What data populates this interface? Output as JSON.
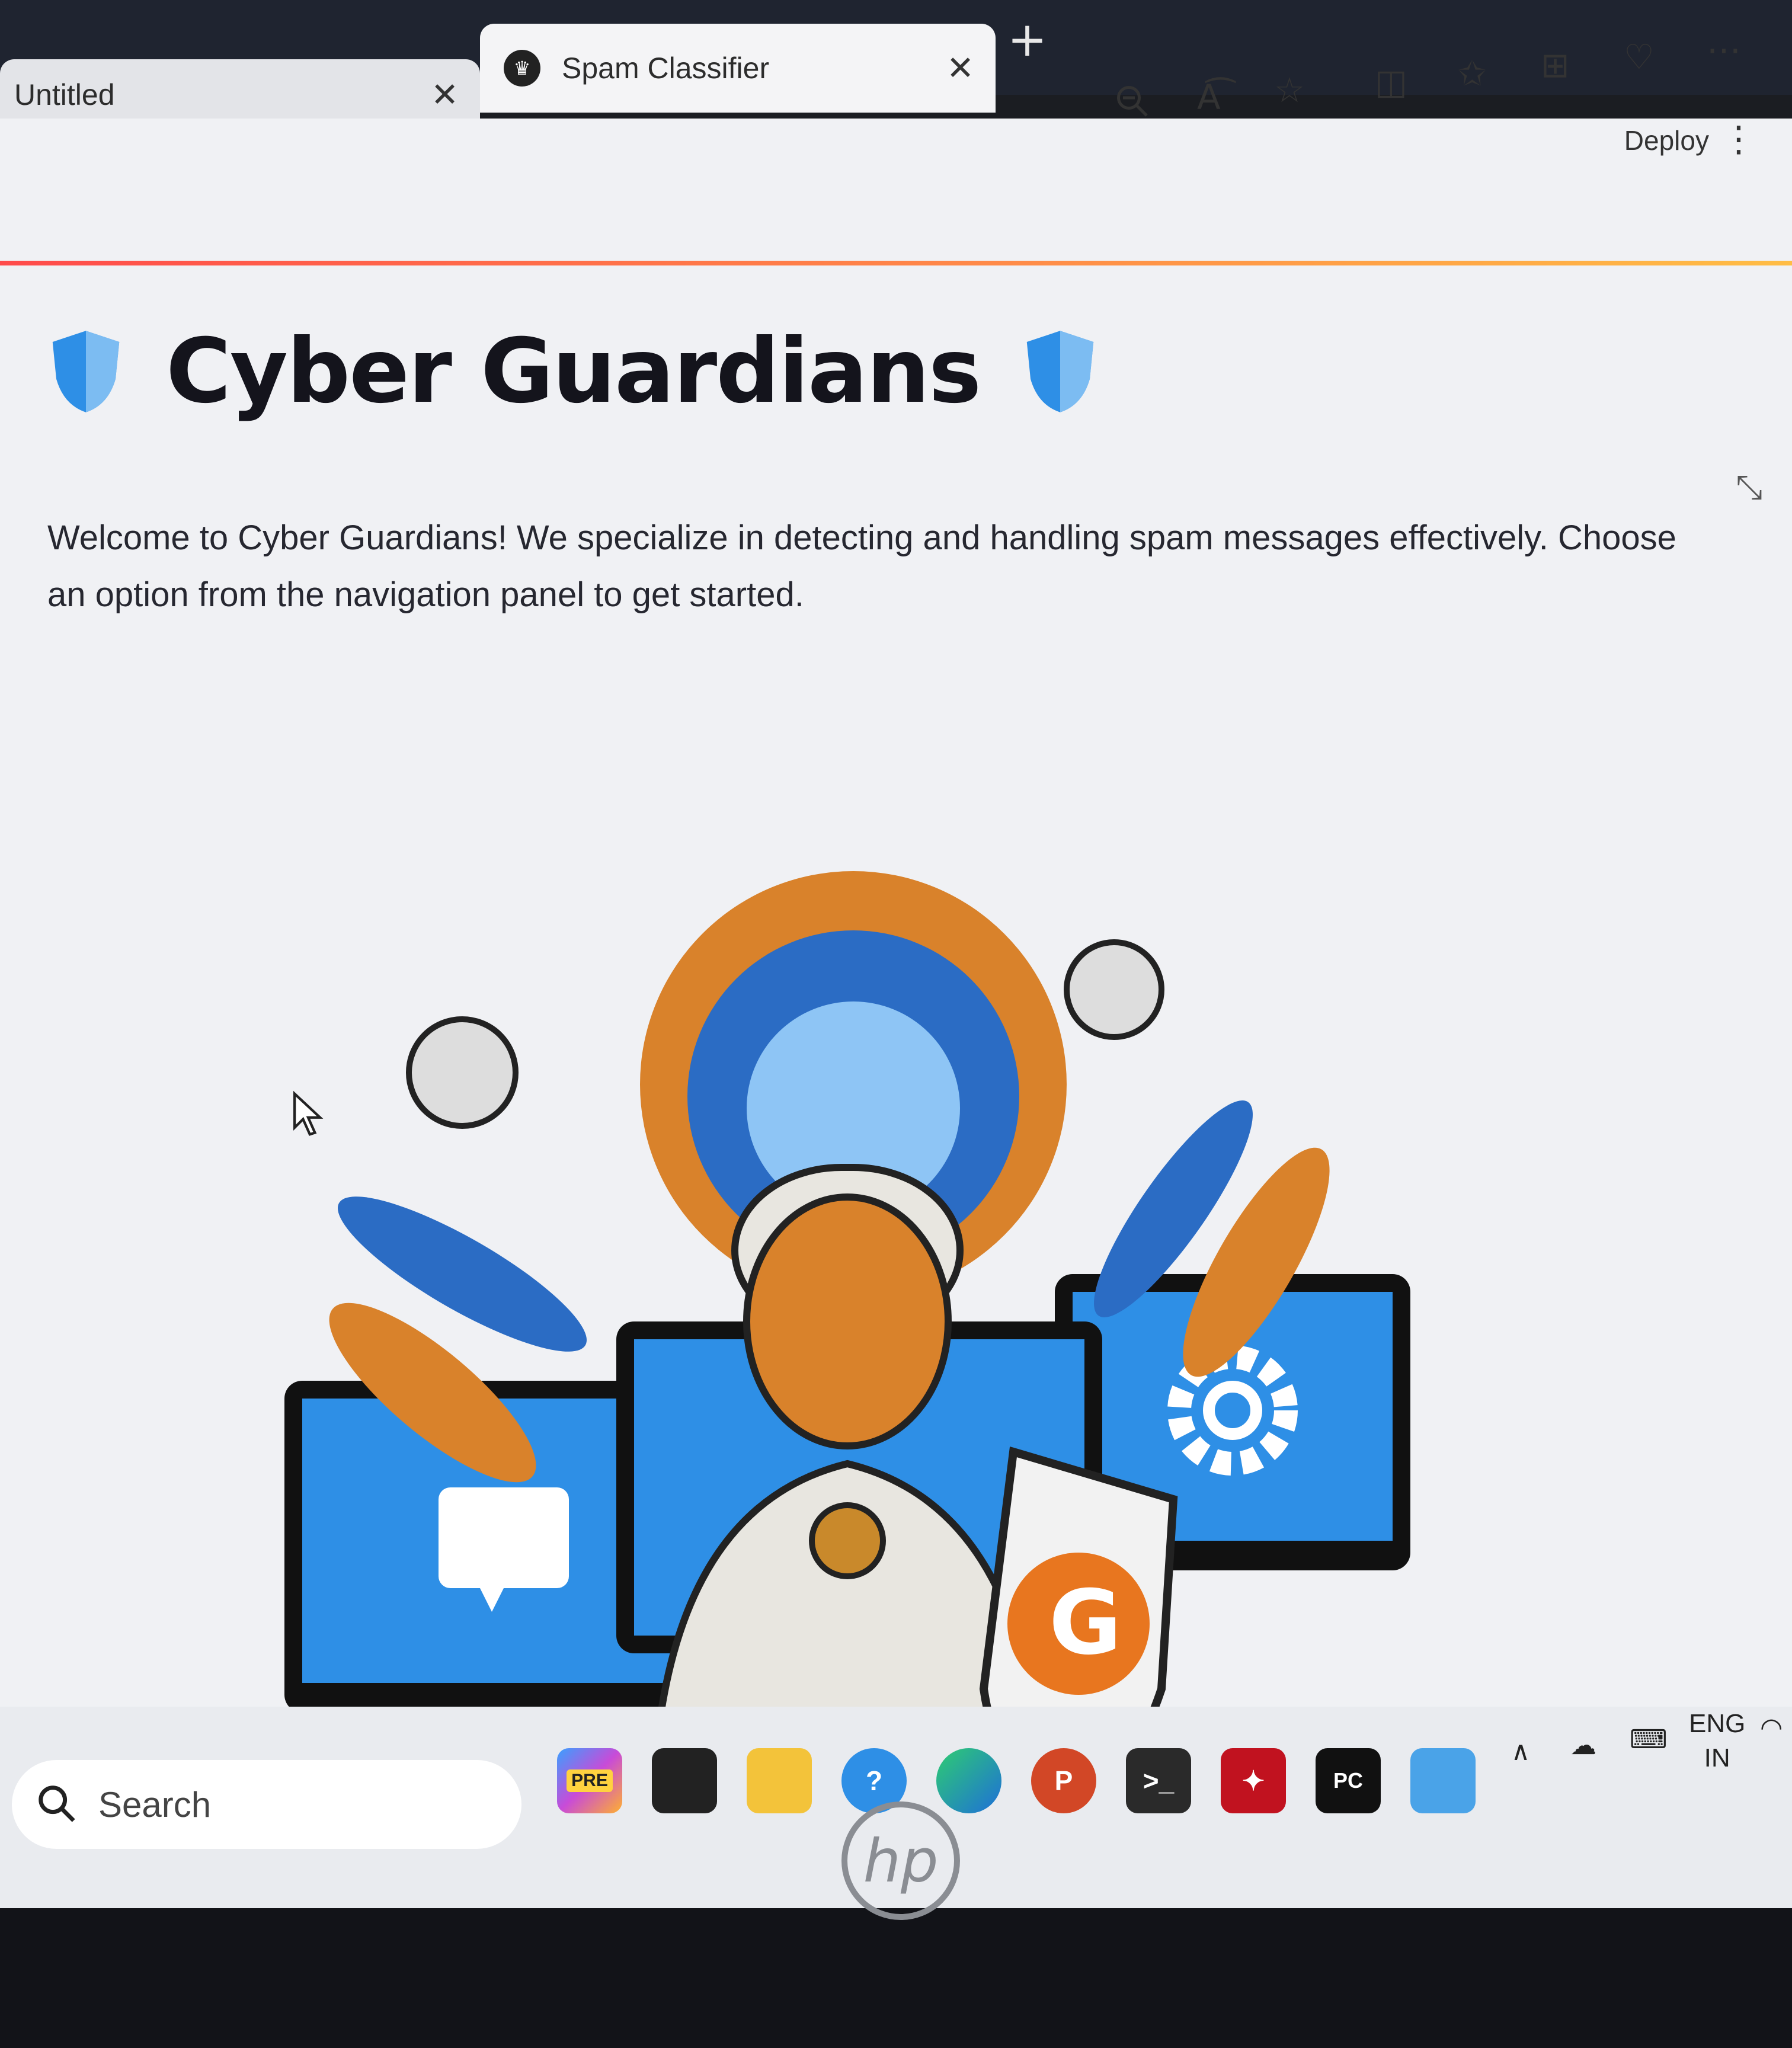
{
  "browser": {
    "tabs": [
      {
        "label": "Untitled",
        "active": false
      },
      {
        "label": "Spam Classifier",
        "active": true
      }
    ],
    "toolbar_icons": [
      "zoom-out-icon",
      "read-aloud-icon",
      "favorite-star-icon",
      "split-screen-icon",
      "favorites-icon",
      "collections-icon",
      "health-icon",
      "more-icon"
    ]
  },
  "app_header": {
    "deploy_label": "Deploy"
  },
  "main": {
    "title": "Cyber Guardians",
    "intro": "Welcome to Cyber Guardians! We specialize in detecting and handling spam messages effectively. Choose an option from the navigation panel to get started."
  },
  "taskbar": {
    "search_label": "Search",
    "apps": [
      "copilot-pre",
      "task-view",
      "file-explorer",
      "get-help",
      "edge",
      "powerpoint",
      "terminal",
      "acrobat",
      "pycharm",
      "notepad"
    ],
    "copilot_badge": "PRE",
    "pycharm_label": "PC",
    "powerpoint_label": "P",
    "lang_line1": "ENG",
    "lang_line2": "IN"
  },
  "colors": {
    "accent_blue": "#2e8fe6",
    "accent_orange": "#e88a2b",
    "streamlit_gradient_start": "#ff4b4b",
    "streamlit_gradient_end": "#ffbd45"
  }
}
